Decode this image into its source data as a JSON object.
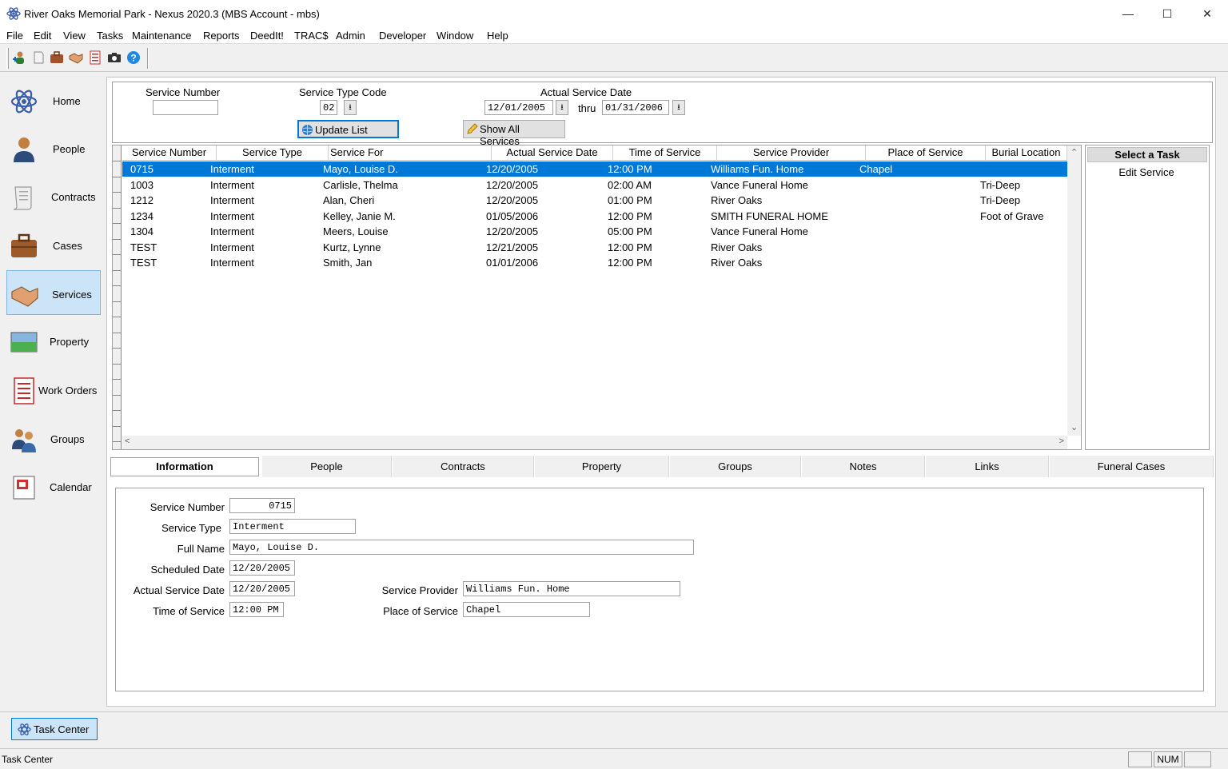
{
  "window": {
    "title": "River Oaks Memorial Park - Nexus 2020.3 (MBS Account - mbs)",
    "minimize": "—",
    "maximize": "☐",
    "close": "✕"
  },
  "menu": [
    "File",
    "Edit",
    "View",
    "Tasks",
    "Maintenance",
    "Reports",
    "DeedIt!",
    "TRAC$",
    "Admin",
    "Developer",
    "Window",
    "Help"
  ],
  "toolbar_icons": [
    "person-add-icon",
    "document-icon",
    "case-icon",
    "handshake-icon",
    "form-icon",
    "camera-icon",
    "help-icon"
  ],
  "sidebar": [
    {
      "label": "Home",
      "icon": "atom-icon"
    },
    {
      "label": "People",
      "icon": "person-icon"
    },
    {
      "label": "Contracts",
      "icon": "scroll-icon"
    },
    {
      "label": "Cases",
      "icon": "briefcase-icon"
    },
    {
      "label": "Services",
      "icon": "handshake-icon",
      "active": true
    },
    {
      "label": "Property",
      "icon": "landscape-icon"
    },
    {
      "label": "Work Orders",
      "icon": "form-icon"
    },
    {
      "label": "Groups",
      "icon": "group-icon"
    },
    {
      "label": "Calendar",
      "icon": "calendar-icon"
    }
  ],
  "filter": {
    "service_number_label": "Service Number",
    "service_number_value": "",
    "service_type_label": "Service Type Code",
    "service_type_value": "02",
    "date_label": "Actual Service Date",
    "date_from": "12/01/2005",
    "thru_label": "thru",
    "date_to": "01/31/2006",
    "update_button": "Update List",
    "show_all_button": "Show All Services",
    "spin_glyph": "⭳"
  },
  "grid": {
    "columns": [
      "Service Number",
      "Service Type",
      "Service For",
      "Actual Service Date",
      "Time of Service",
      "Service Provider",
      "Place of Service",
      "Burial Location"
    ],
    "rows": [
      [
        "0715",
        "Interment",
        "Mayo, Louise D.",
        "12/20/2005",
        "12:00 PM",
        "Williams Fun. Home",
        "Chapel",
        ""
      ],
      [
        "1003",
        "Interment",
        "Carlisle, Thelma",
        "12/20/2005",
        "02:00 AM",
        "Vance Funeral Home",
        "",
        "Tri-Deep"
      ],
      [
        "1212",
        "Interment",
        "Alan, Cheri",
        "12/20/2005",
        "01:00 PM",
        "River Oaks",
        "",
        "Tri-Deep"
      ],
      [
        "1234",
        "Interment",
        "Kelley, Janie M.",
        "01/05/2006",
        "12:00 PM",
        "SMITH FUNERAL HOME",
        "",
        "Foot of Grave"
      ],
      [
        "1304",
        "Interment",
        "Meers, Louise",
        "12/20/2005",
        "05:00 PM",
        "Vance Funeral Home",
        "",
        ""
      ],
      [
        "TEST",
        "Interment",
        "Kurtz, Lynne",
        "12/21/2005",
        "12:00 PM",
        "River Oaks",
        "",
        ""
      ],
      [
        "TEST",
        "Interment",
        "Smith, Jan",
        "01/01/2006",
        "12:00 PM",
        "River Oaks",
        "",
        ""
      ]
    ],
    "selected_row": 0
  },
  "tasks": {
    "header": "Select a Task",
    "items": [
      "Edit Service"
    ]
  },
  "tabs": [
    "Information",
    "People",
    "Contracts",
    "Property",
    "Groups",
    "Notes",
    "Links",
    "Funeral Cases"
  ],
  "info": {
    "service_number_label": "Service Number",
    "service_number": "0715",
    "service_type_label": "Service Type",
    "service_type": "Interment",
    "full_name_label": "Full Name",
    "full_name": "Mayo, Louise D.",
    "scheduled_date_label": "Scheduled Date",
    "scheduled_date": "12/20/2005",
    "actual_date_label": "Actual Service Date",
    "actual_date": "12/20/2005",
    "time_label": "Time of Service",
    "time": "12:00 PM",
    "provider_label": "Service Provider",
    "provider": "Williams Fun. Home",
    "place_label": "Place of Service",
    "place": "Chapel"
  },
  "bottom": {
    "task_center_button": "Task Center",
    "status_text": "Task Center",
    "num_indicator": "NUM"
  },
  "colors": {
    "selection": "#0078d7",
    "active_nav": "#cce4f7"
  }
}
